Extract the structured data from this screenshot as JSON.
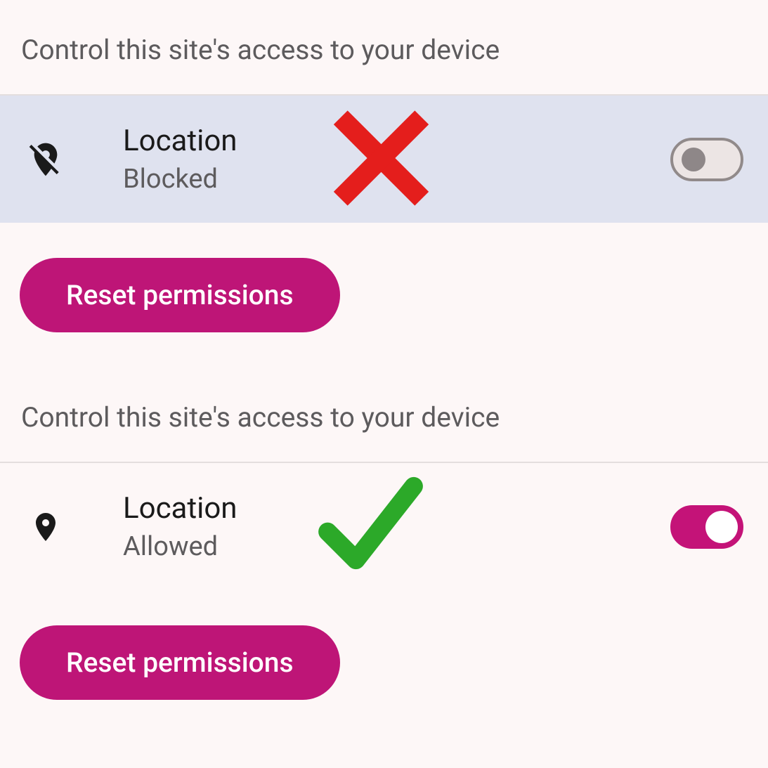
{
  "panels": [
    {
      "header": "Control this site's access to your device",
      "permission": {
        "title": "Location",
        "status": "Blocked",
        "enabled": false
      },
      "reset_label": "Reset permissions",
      "mark": "x"
    },
    {
      "header": "Control this site's access to your device",
      "permission": {
        "title": "Location",
        "status": "Allowed",
        "enabled": true
      },
      "reset_label": "Reset permissions",
      "mark": "check"
    }
  ],
  "colors": {
    "accent": "#be1577",
    "x_mark": "#e41e1c",
    "check_mark": "#2ca929"
  }
}
